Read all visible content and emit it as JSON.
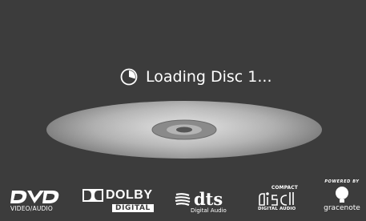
{
  "status": {
    "text": "Loading Disc 1...",
    "icon": "loading-spinner-icon"
  },
  "disc": {
    "icon": "compact-disc-image"
  },
  "colors": {
    "background": "#3c3c3c",
    "text": "#ffffff"
  },
  "logos": {
    "dvd": {
      "mark": "DVD",
      "subtitle": "VIDEO/AUDIO"
    },
    "dolby": {
      "word": "DOLBY",
      "sub": "DIGITAL"
    },
    "dts": {
      "word": "dts",
      "sub": "Digital Audio",
      "tm": "TM"
    },
    "cd": {
      "top": "COMPACT",
      "mark": "disc",
      "bottom": "DIGITAL AUDIO"
    },
    "gracenote": {
      "top": "POWERED BY",
      "word": "gracenote"
    }
  }
}
